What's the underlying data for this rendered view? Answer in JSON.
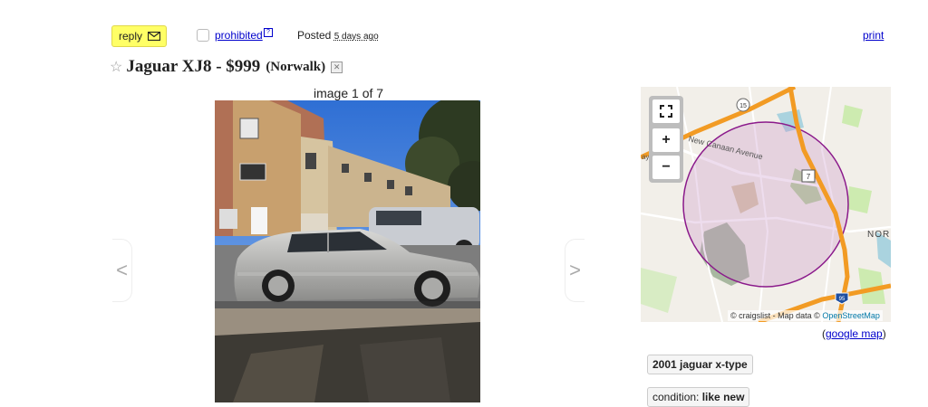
{
  "header": {
    "reply_label": "reply",
    "prohibited_label": "prohibited",
    "help_glyph": "?",
    "posted_label": "Posted",
    "posted_ago": "5 days ago",
    "print_label": "print"
  },
  "listing": {
    "title": "Jaguar XJ8 - $999",
    "location": "(Norwalk)",
    "image_counter": "image 1 of 7",
    "prev_arrow": "<",
    "next_arrow": ">"
  },
  "map": {
    "street_label": "New Canaan Avenue",
    "place_label": "NOR",
    "route_15": "15",
    "route_7": "7",
    "route_95": "95",
    "zoom_in": "+",
    "zoom_out": "−",
    "attribution_prefix": "© craigslist - Map data ©",
    "attribution_link": "OpenStreetMap",
    "google_map_link": "google map"
  },
  "attributes": {
    "model": "2001 jaguar x-type",
    "condition_label": "condition:",
    "condition_value": "like new"
  },
  "colors": {
    "reply_bg": "#ffff66",
    "link": "#0000cc",
    "radius_circle": "#8b1a8b",
    "highway": "#f29b24"
  }
}
